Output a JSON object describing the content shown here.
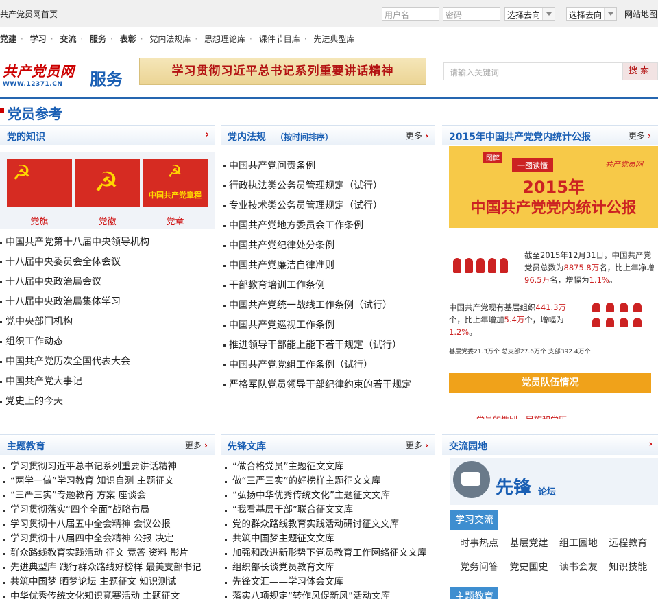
{
  "topbar": {
    "home": "共产党员网首页",
    "username_placeholder": "用户名",
    "password_placeholder": "密码",
    "select1": "选择去向",
    "select2": "选择去向",
    "sitemap": "网站地图"
  },
  "nav": {
    "items": [
      "党建",
      "学习",
      "交流",
      "服务",
      "表彰",
      "党内法规库",
      "思想理论库",
      "课件节目库",
      "先进典型库"
    ]
  },
  "header": {
    "logo_cn": "共产党员网",
    "logo_en": "WWW.12371.CN",
    "service": "服务",
    "banner": "学习贯彻习近平总书记系列重要讲话精神",
    "search_placeholder": "请输入关键词",
    "search_button": "搜索"
  },
  "section_title": "党员参考",
  "knowledge": {
    "title": "党的知识",
    "flags": [
      {
        "label": "党旗",
        "text": ""
      },
      {
        "label": "党徽",
        "text": ""
      },
      {
        "label": "党章",
        "text": "中国共产党章程"
      }
    ],
    "items": [
      "中国共产党第十八届中央领导机构",
      "十八届中央委员会全体会议",
      "十八届中央政治局会议",
      "十八届中央政治局集体学习",
      "党中央部门机构",
      "组织工作动态",
      "中国共产党历次全国代表大会",
      "中国共产党大事记",
      "党史上的今天"
    ]
  },
  "regulations": {
    "title": "党内法规",
    "subtitle": "（按时间排序）",
    "more": "更多",
    "items": [
      "中国共产党问责条例",
      "行政执法类公务员管理规定（试行）",
      "专业技术类公务员管理规定（试行）",
      "中国共产党地方委员会工作条例",
      "中国共产党纪律处分条例",
      "中国共产党廉洁自律准则",
      "干部教育培训工作条例",
      "中国共产党统一战线工作条例（试行）",
      "中国共产党巡视工作条例",
      "推进领导干部能上能下若干规定（试行）",
      "中国共产党党组工作条例（试行）",
      "严格军队党员领导干部纪律约束的若干规定"
    ]
  },
  "stats": {
    "title": "2015年中国共产党党内统计公报",
    "more": "更多",
    "info_tag1": "图解",
    "info_tag2": "一图读懂",
    "info_mini": "共产党员网",
    "info_title1": "2015年",
    "info_title2": "中国共产党党内统计公报",
    "p1_a": "截至2015年12月31日，中国共产党党员总数为",
    "p1_b": "8875.8万",
    "p1_c": "名，比上年净增",
    "p1_d": "96.5万",
    "p1_e": "名，增幅为",
    "p1_f": "1.1%",
    "p1_g": "。",
    "p2_a": "中国共产党现有基层组织",
    "p2_b": "441.3万",
    "p2_c": "个，比上年增加",
    "p2_d": "5.4万",
    "p2_e": "个，增幅为",
    "p2_f": "1.2%",
    "p2_g": "。",
    "p3": "基层党委21.3万个  总支部27.6万个  支部392.4万个",
    "bar": "党员队伍情况",
    "cut": "党员的性别、民族和学历"
  },
  "education": {
    "title": "主题教育",
    "more": "更多",
    "items": [
      "学习贯彻习近平总书记系列重要讲话精神",
      "“两学一做”学习教育  知识自测  主题征文",
      "“三严三实”专题教育  方案  座谈会",
      "学习贯彻落实“四个全面”战略布局",
      "学习贯彻十八届五中全会精神  会议公报",
      "学习贯彻十八届四中全会精神  公报  决定",
      "群众路线教育实践活动  征文  竞答  资料  影片",
      "先进典型库  践行群众路线好榜样  最美支部书记",
      "共筑中国梦  晒梦论坛  主题征文  知识测试",
      "中华优秀传统文化知识竞赛活动  主题征文"
    ]
  },
  "library": {
    "title": "先锋文库",
    "more": "更多",
    "items": [
      "“做合格党员”主题征文文库",
      "做“三严三实”的好榜样主题征文文库",
      "“弘扬中华优秀传统文化”主题征文文库",
      "“我看基层干部”联合征文文库",
      "党的群众路线教育实践活动研讨征文文库",
      "共筑中国梦主题征文文库",
      "加强和改进新形势下党员教育工作网络征文文库",
      "组织部长谈党员教育文库",
      "先锋文汇——学习体会文库",
      "落实八项规定“转作风促新风”活动文库"
    ]
  },
  "exchange": {
    "title": "交流园地",
    "forum_name": "先锋",
    "forum_sub": "论坛",
    "tag1": "学习交流",
    "row1": [
      "时事热点",
      "基层党建",
      "组工园地",
      "远程教育"
    ],
    "row2": [
      "党务问答",
      "党史国史",
      "读书会友",
      "知识技能"
    ],
    "tag2": "主题教育"
  },
  "colors": {
    "brand_red": "#cc0000",
    "brand_blue": "#1a5fb4",
    "accent_gold": "#f7c948"
  }
}
